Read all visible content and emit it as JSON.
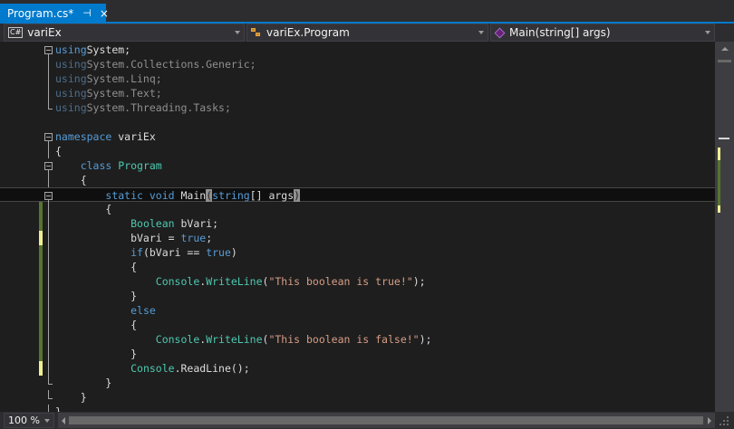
{
  "tab": {
    "title": "Program.cs*",
    "pin_icon": "pin-icon",
    "close_icon": "close-icon",
    "pin_glyph": "⊣",
    "close_glyph": "×"
  },
  "nav": {
    "project": "variEx",
    "class": "variEx.Program",
    "member": "Main(string[] args)",
    "cs_badge": "C#"
  },
  "code": [
    {
      "fold": "open",
      "text": [
        [
          "kw",
          "using"
        ],
        [
          "",
          "System;"
        ]
      ]
    },
    {
      "fold": "line",
      "dim": true,
      "text": [
        [
          "kw",
          "using"
        ],
        [
          "",
          "System.Collections.Generic;"
        ]
      ]
    },
    {
      "fold": "line",
      "dim": true,
      "text": [
        [
          "kw",
          "using"
        ],
        [
          "",
          "System.Linq;"
        ]
      ]
    },
    {
      "fold": "line",
      "dim": true,
      "text": [
        [
          "kw",
          "using"
        ],
        [
          "",
          "System.Text;"
        ]
      ]
    },
    {
      "fold": "end",
      "dim": true,
      "text": [
        [
          "kw",
          "using"
        ],
        [
          "",
          "System.Threading.Tasks;"
        ]
      ]
    },
    {
      "fold": "",
      "text": []
    },
    {
      "fold": "open",
      "text": [
        [
          "kw",
          "namespace"
        ],
        [
          "",
          " variEx"
        ]
      ]
    },
    {
      "fold": "line",
      "text": [
        [
          "",
          "{"
        ]
      ]
    },
    {
      "fold": "open",
      "text": [
        [
          "",
          "    "
        ],
        [
          "kw",
          "class"
        ],
        [
          "",
          " "
        ],
        [
          "ty",
          "Program"
        ]
      ]
    },
    {
      "fold": "line",
      "text": [
        [
          "",
          "    {"
        ]
      ]
    },
    {
      "fold": "open",
      "current": true,
      "text": [
        [
          "",
          "        "
        ],
        [
          "kw",
          "static"
        ],
        [
          "",
          " "
        ],
        [
          "kw",
          "void"
        ],
        [
          "",
          " Main"
        ],
        [
          "hl",
          "("
        ],
        [
          "kw",
          "string"
        ],
        [
          "",
          "[] args"
        ],
        [
          "hl",
          ")"
        ]
      ]
    },
    {
      "fold": "line",
      "change": "saved",
      "text": [
        [
          "",
          "        {"
        ]
      ]
    },
    {
      "fold": "line",
      "change": "saved",
      "text": [
        [
          "",
          "            "
        ],
        [
          "ty",
          "Boolean"
        ],
        [
          "",
          " bVari;"
        ]
      ]
    },
    {
      "fold": "line",
      "change": "unsaved",
      "text": [
        [
          "",
          "            bVari = "
        ],
        [
          "kw",
          "true"
        ],
        [
          "",
          ";"
        ]
      ]
    },
    {
      "fold": "line",
      "change": "saved",
      "text": [
        [
          "",
          "            "
        ],
        [
          "kw",
          "if"
        ],
        [
          "",
          "(bVari == "
        ],
        [
          "kw",
          "true"
        ],
        [
          "",
          ")"
        ]
      ]
    },
    {
      "fold": "line",
      "change": "saved",
      "text": [
        [
          "",
          "            {"
        ]
      ]
    },
    {
      "fold": "line",
      "change": "saved",
      "text": [
        [
          "",
          "                "
        ],
        [
          "ty",
          "Console"
        ],
        [
          "",
          "."
        ],
        [
          "ty",
          "WriteLine"
        ],
        [
          "",
          "("
        ],
        [
          "st",
          "\"This boolean is true!\""
        ],
        [
          "",
          ");"
        ]
      ]
    },
    {
      "fold": "line",
      "change": "saved",
      "text": [
        [
          "",
          "            }"
        ]
      ]
    },
    {
      "fold": "line",
      "change": "saved",
      "text": [
        [
          "",
          "            "
        ],
        [
          "kw",
          "else"
        ]
      ]
    },
    {
      "fold": "line",
      "change": "saved",
      "text": [
        [
          "",
          "            {"
        ]
      ]
    },
    {
      "fold": "line",
      "change": "saved",
      "text": [
        [
          "",
          "                "
        ],
        [
          "ty",
          "Console"
        ],
        [
          "",
          "."
        ],
        [
          "ty",
          "WriteLine"
        ],
        [
          "",
          "("
        ],
        [
          "st",
          "\"This boolean is false!\""
        ],
        [
          "",
          ");"
        ]
      ]
    },
    {
      "fold": "line",
      "change": "saved",
      "text": [
        [
          "",
          "            }"
        ]
      ]
    },
    {
      "fold": "line",
      "change": "unsaved",
      "text": [
        [
          "",
          "            "
        ],
        [
          "ty",
          "Console"
        ],
        [
          "",
          ".ReadLine();"
        ]
      ]
    },
    {
      "fold": "end",
      "text": [
        [
          "",
          "        }"
        ]
      ]
    },
    {
      "fold": "end",
      "text": [
        [
          "",
          "    }"
        ]
      ]
    },
    {
      "fold": "end",
      "text": [
        [
          "",
          "}"
        ]
      ]
    }
  ],
  "zoom": "100 %",
  "colors": {
    "accent": "#007acc",
    "editor_bg": "#1e1e1e",
    "keyword": "#569cd6",
    "type": "#4ec9b0",
    "string": "#d69d85",
    "saved_change": "#577430",
    "unsaved_change": "#efef91"
  }
}
